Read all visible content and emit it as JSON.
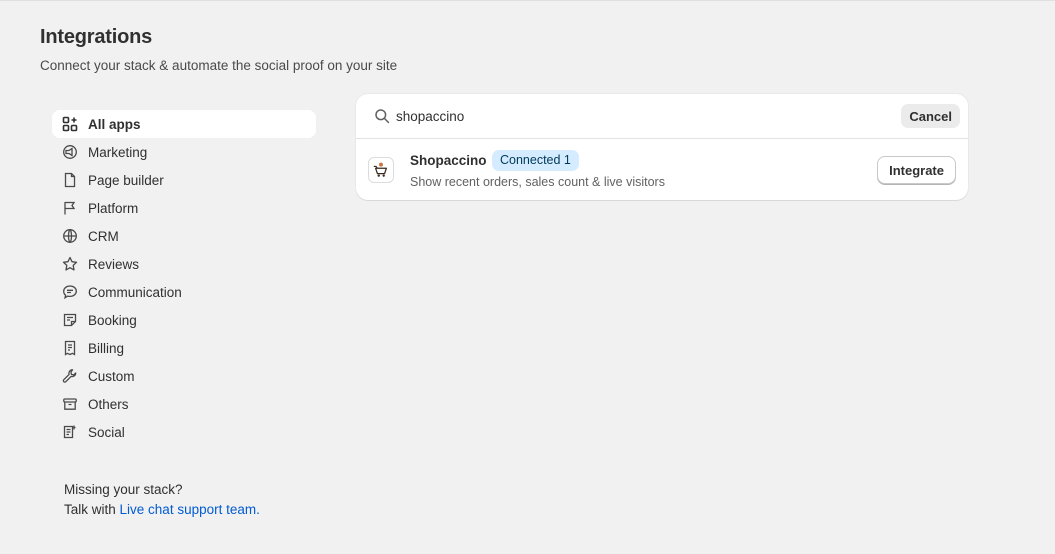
{
  "header": {
    "title": "Integrations",
    "subtitle": "Connect your stack & automate the social proof on your site"
  },
  "sidebar": {
    "items": [
      {
        "label": "All apps",
        "icon": "apps-grid-icon",
        "active": true
      },
      {
        "label": "Marketing",
        "icon": "megaphone-icon"
      },
      {
        "label": "Page builder",
        "icon": "page-icon"
      },
      {
        "label": "Platform",
        "icon": "flag-icon"
      },
      {
        "label": "CRM",
        "icon": "globe-icon"
      },
      {
        "label": "Reviews",
        "icon": "star-icon"
      },
      {
        "label": "Communication",
        "icon": "chat-icon"
      },
      {
        "label": "Booking",
        "icon": "note-icon"
      },
      {
        "label": "Billing",
        "icon": "receipt-icon"
      },
      {
        "label": "Custom",
        "icon": "wrench-icon"
      },
      {
        "label": "Others",
        "icon": "package-icon"
      },
      {
        "label": "Social",
        "icon": "social-list-icon"
      }
    ]
  },
  "missing": {
    "line1": "Missing your stack?",
    "line2_prefix": "Talk with ",
    "link_text": "Live chat support team."
  },
  "search": {
    "value": "shopaccino",
    "cancel_label": "Cancel"
  },
  "results": [
    {
      "name": "Shopaccino",
      "badge": "Connected 1",
      "description": "Show recent orders, sales count & live visitors",
      "action_label": "Integrate"
    }
  ],
  "colors": {
    "background": "#f1f1f1",
    "link": "#005bd3",
    "badge_bg": "#d5ebff"
  }
}
